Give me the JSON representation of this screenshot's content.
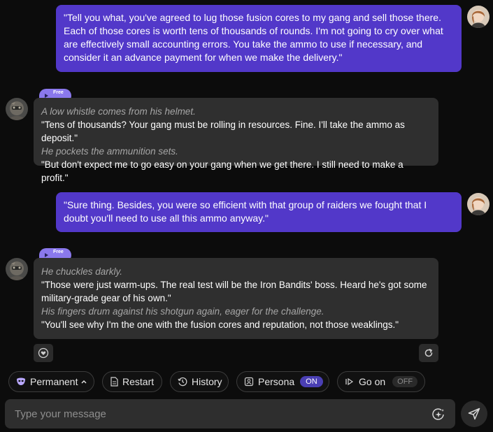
{
  "messages": [
    {
      "role": "user",
      "text": "\"Tell you what, you've agreed to lug those fusion cores to my gang and sell those there. Each of those cores is worth tens of thousands of rounds. I'm not going to cry over what are effectively small accounting errors. You take the ammo to use if necessary, and consider it an advance payment for when we make the delivery.\""
    },
    {
      "role": "bot",
      "tag": "Free",
      "lines": [
        {
          "kind": "action",
          "text": "A low whistle comes from his helmet."
        },
        {
          "kind": "speech",
          "text": "\"Tens of thousands? Your gang must be rolling in resources. Fine. I'll take the ammo as deposit.\""
        },
        {
          "kind": "action",
          "text": "He pockets the ammunition sets."
        },
        {
          "kind": "speech",
          "text": "\"But don't expect me to go easy on your gang when we get there. I still need to make a profit.\""
        }
      ]
    },
    {
      "role": "user",
      "text": "\"Sure thing. Besides, you were so efficient with that group of raiders we fought that I doubt you'll need to use all this ammo anyway.\""
    },
    {
      "role": "bot",
      "tag": "Free",
      "lines": [
        {
          "kind": "action",
          "text": "He chuckles darkly."
        },
        {
          "kind": "speech",
          "text": "\"Those were just warm-ups. The real test will be the Iron Bandits' boss. Heard he's got some military-grade gear of his own.\""
        },
        {
          "kind": "action",
          "text": "His fingers drum against his shotgun again, eager for the challenge."
        },
        {
          "kind": "speech",
          "text": "\"You'll see why I'm the one with the fusion cores and reputation, not those weaklings.\""
        }
      ]
    }
  ],
  "toolbar": {
    "permanent": "Permanent",
    "restart": "Restart",
    "history": "History",
    "persona": "Persona",
    "persona_state": "ON",
    "go_on": "Go on",
    "go_on_state": "OFF"
  },
  "composer": {
    "placeholder": "Type your message"
  },
  "icons": {
    "user_avatar": "user-avatar",
    "bot_avatar": "bot-avatar",
    "play": "play-icon",
    "like": "heart-icon",
    "regenerate": "refresh-icon",
    "mask": "mask-icon",
    "doc": "document-icon",
    "history": "clock-icon",
    "persona": "persona-card-icon",
    "go_on": "skip-forward-icon",
    "sparkle": "sparkle-icon",
    "send": "send-icon"
  },
  "colors": {
    "user_bubble": "#5238c9",
    "bot_bubble": "#2f2f2f",
    "free_tag": "#8a78ec",
    "background": "#0c0c0c",
    "badge_on": "#4a3fb4"
  }
}
